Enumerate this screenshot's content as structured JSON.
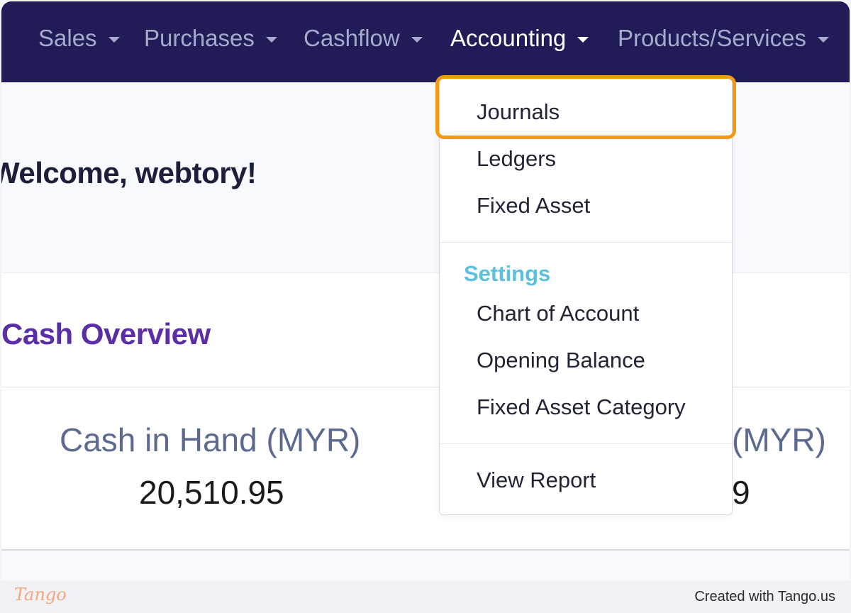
{
  "nav": {
    "items": [
      {
        "label": "Sales"
      },
      {
        "label": "Purchases"
      },
      {
        "label": "Cashflow"
      },
      {
        "label": "Accounting"
      },
      {
        "label": "Products/Services"
      }
    ]
  },
  "welcome": {
    "text": "Welcome, webtory!"
  },
  "cash_overview": {
    "title": "Cash Overview",
    "stats": [
      {
        "label": "Cash in Hand (MYR)",
        "value": "20,510.95"
      },
      {
        "label": "(MYR)",
        "value": "9"
      }
    ]
  },
  "accounting_menu": {
    "items": [
      "Journals",
      "Ledgers",
      "Fixed Asset"
    ],
    "settings_header": "Settings",
    "settings_items": [
      "Chart of Account",
      "Opening Balance",
      "Fixed Asset Category"
    ],
    "report_item": "View Report",
    "highlighted": "Journals"
  },
  "footer": {
    "logo": "Tango",
    "created_text": "Created with Tango.us"
  },
  "colors": {
    "navbar": "#201c58",
    "highlight": "#f29a12",
    "settings_header": "#5bc0de",
    "card_title": "#5a2ea6"
  }
}
